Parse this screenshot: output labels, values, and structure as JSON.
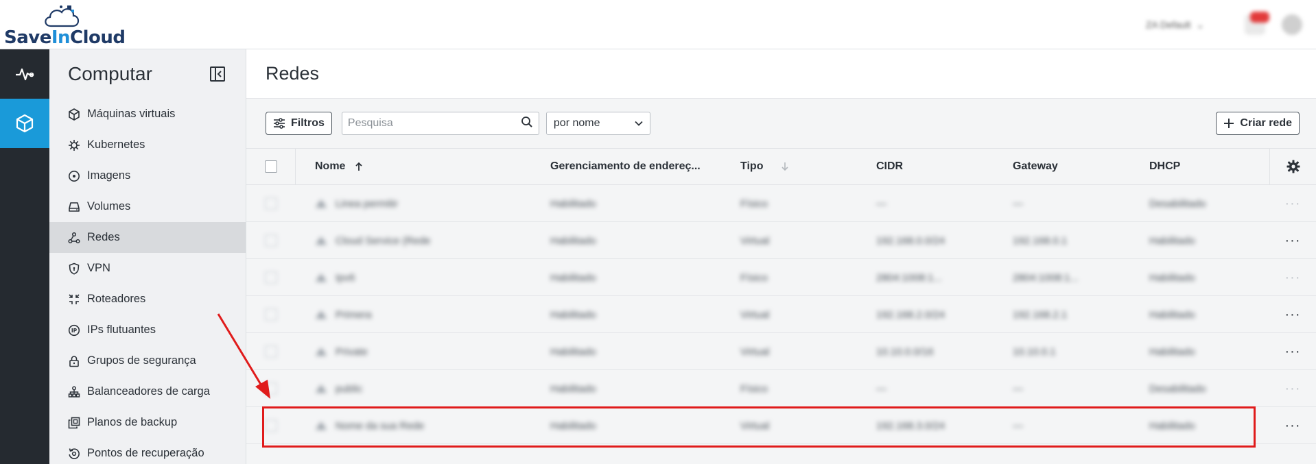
{
  "brand": {
    "logo_text_a": "Save",
    "logo_text_b": "In",
    "logo_text_c": "Cloud"
  },
  "topbar": {
    "region_label": "ZA Default"
  },
  "sidenav": {
    "title": "Computar",
    "items": [
      {
        "label": "Máquinas virtuais",
        "icon": "cube-icon"
      },
      {
        "label": "Kubernetes",
        "icon": "helm-icon"
      },
      {
        "label": "Imagens",
        "icon": "disc-icon"
      },
      {
        "label": "Volumes",
        "icon": "drive-icon"
      },
      {
        "label": "Redes",
        "icon": "network-icon",
        "active": true
      },
      {
        "label": "VPN",
        "icon": "shield-icon"
      },
      {
        "label": "Roteadores",
        "icon": "router-icon"
      },
      {
        "label": "IPs flutuantes",
        "icon": "ip-icon"
      },
      {
        "label": "Grupos de segurança",
        "icon": "lock-icon"
      },
      {
        "label": "Balanceadores de carga",
        "icon": "balancer-icon"
      },
      {
        "label": "Planos de backup",
        "icon": "backup-icon"
      },
      {
        "label": "Pontos de recuperação",
        "icon": "restore-icon"
      }
    ]
  },
  "main": {
    "title": "Redes",
    "filters_label": "Filtros",
    "search_placeholder": "Pesquisa",
    "sort_value": "por nome",
    "create_label": "Criar rede"
  },
  "table": {
    "columns": {
      "name": "Nome",
      "address_mgmt": "Gerenciamento de endereç...",
      "type": "Tipo",
      "cidr": "CIDR",
      "gateway": "Gateway",
      "dhcp": "DHCP"
    },
    "rows": [
      {
        "name": "Linea permitir",
        "mgmt": "Habilitado",
        "type": "Físico",
        "cidr": "—",
        "gateway": "—",
        "dhcp": "Desabilitado",
        "actions_enabled": false
      },
      {
        "name": "Cloud Service (Rede",
        "mgmt": "Habilitado",
        "type": "Virtual",
        "cidr": "192.168.0.0/24",
        "gateway": "192.168.0.1",
        "dhcp": "Habilitado",
        "actions_enabled": true
      },
      {
        "name": "Ipv6",
        "mgmt": "Habilitado",
        "type": "Físico",
        "cidr": "2804:1008:1...",
        "gateway": "2804:1008:1...",
        "dhcp": "Habilitado",
        "actions_enabled": false
      },
      {
        "name": "Primera",
        "mgmt": "Habilitado",
        "type": "Virtual",
        "cidr": "192.168.2.0/24",
        "gateway": "192.168.2.1",
        "dhcp": "Habilitado",
        "actions_enabled": true
      },
      {
        "name": "Private",
        "mgmt": "Habilitado",
        "type": "Virtual",
        "cidr": "10.10.0.0/16",
        "gateway": "10.10.0.1",
        "dhcp": "Habilitado",
        "actions_enabled": true
      },
      {
        "name": "public",
        "mgmt": "Habilitado",
        "type": "Físico",
        "cidr": "—",
        "gateway": "—",
        "dhcp": "Desabilitado",
        "actions_enabled": false
      },
      {
        "name": "Nome da sua Rede",
        "mgmt": "Habilitado",
        "type": "Virtual",
        "cidr": "192.168.3.0/24",
        "gateway": "—",
        "dhcp": "Habilitado",
        "actions_enabled": true
      }
    ]
  },
  "colors": {
    "accent": "#1a9ad9",
    "rail": "#252a30",
    "annotation": "#e01b1b"
  }
}
